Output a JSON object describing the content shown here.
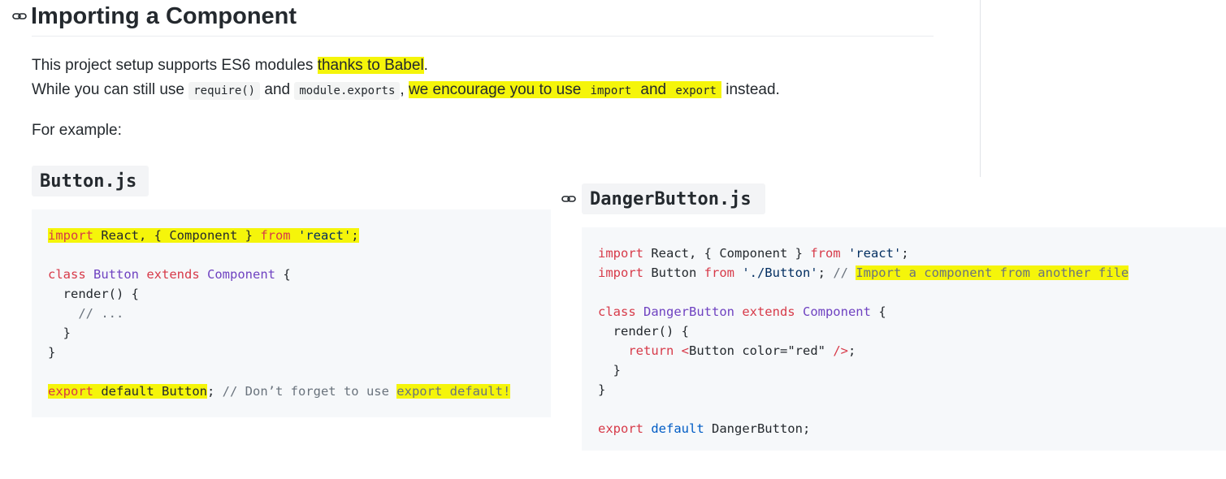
{
  "heading": {
    "title": "Importing a Component"
  },
  "para1": {
    "text_a": "This project setup supports ES6 modules ",
    "text_hl": "thanks to Babel",
    "text_b": "."
  },
  "para2": {
    "text_a": "While you can still use ",
    "code1": "require()",
    "text_and": " and ",
    "code2": "module.exports",
    "text_comma": ", ",
    "hl_a": "we encourage you to use ",
    "code3": "import",
    "hl_and": " and ",
    "code4": "export",
    "text_end": " instead."
  },
  "para3": {
    "text": "For example:"
  },
  "file1": {
    "name": "Button.js"
  },
  "file2": {
    "name": "DangerButton.js"
  },
  "code_button": {
    "l1": {
      "import": "import",
      "react_comp": " React, { Component } ",
      "from": "from",
      "str": " 'react'",
      "semi": ";"
    },
    "l3": {
      "class": "class ",
      "name": "Button",
      "extends": " extends ",
      "comp": "Component",
      "brace": " {"
    },
    "l4": "  render() {",
    "l5": "    // ...",
    "l6": "  }",
    "l7": "}",
    "l9": {
      "export": "export",
      "default": " default",
      "name": " Button",
      "semi": ";",
      "comment": " // Don’t forget to use ",
      "comment_hl": "export default!"
    }
  },
  "code_danger": {
    "l1": {
      "import": "import",
      "rest": " React, { Component } ",
      "from": "from",
      "str": " 'react'",
      "semi": ";"
    },
    "l2": {
      "import": "import",
      "rest": " Button ",
      "from": "from",
      "str": " './Button'",
      "semi": "; ",
      "comment": "// ",
      "comment_hl": "Import a component from another file"
    },
    "l4": {
      "class": "class ",
      "name": "DangerButton",
      "extends": " extends ",
      "comp": "Component",
      "brace": " {"
    },
    "l5": "  render() {",
    "l6": {
      "return": "    return",
      "tag_open": " <",
      "tag": "Button",
      "attr": " color=",
      "val": "\"red\"",
      "tag_close": " />",
      "semi": ";"
    },
    "l7": "  }",
    "l8": "}",
    "l10": {
      "export": "export",
      "default": " default",
      "name": " DangerButton;"
    }
  },
  "colors": {
    "highlight": "#f5f50a",
    "keyword": "#d73a49",
    "class": "#6f42c1",
    "string": "#032f62",
    "comment": "#6a737d"
  },
  "icons": [
    "link-icon"
  ]
}
